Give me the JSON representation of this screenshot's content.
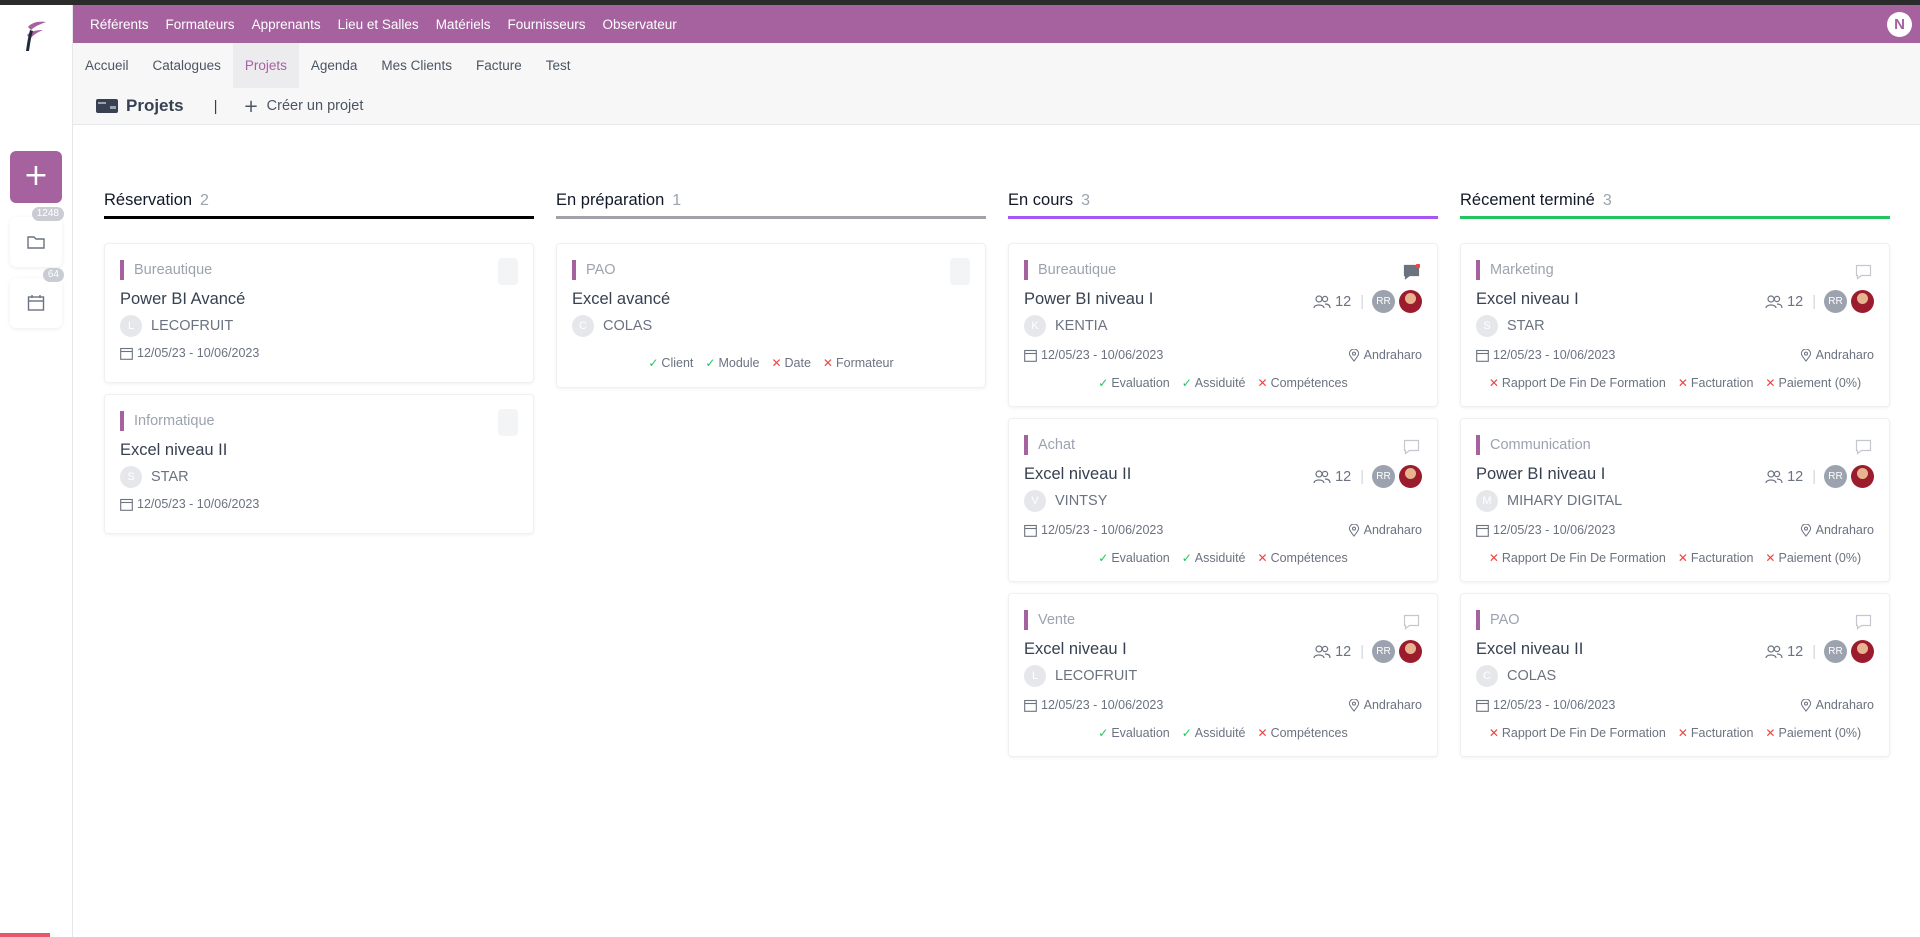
{
  "nav": {
    "top": [
      "Référents",
      "Formateurs",
      "Apprenants",
      "Lieu et Salles",
      "Matériels",
      "Fournisseurs",
      "Observateur"
    ],
    "user_initial": "N",
    "sub": [
      "Accueil",
      "Catalogues",
      "Projets",
      "Agenda",
      "Mes Clients",
      "Facture",
      "Test"
    ],
    "active_sub": "Projets"
  },
  "sidebar": {
    "add_label": "+",
    "folder_badge": "1248",
    "calendar_badge": "64"
  },
  "page": {
    "title": "Projets",
    "separator": "|",
    "create_label": "Créer un projet"
  },
  "colors": {
    "brand": "#a5629f",
    "col_reservation": "#000000",
    "col_preparation": "#a1a1aa",
    "col_encours": "#a855f7",
    "col_termine": "#22c55e"
  },
  "columns": [
    {
      "title": "Réservation",
      "count": "2",
      "cards": [
        {
          "category": "Bureautique",
          "name": "Power BI Avancé",
          "client_initial": "L",
          "client": "LECOFRUIT",
          "dates": "12/05/23 - 10/06/2023"
        },
        {
          "category": "Informatique",
          "name": "Excel niveau II",
          "client_initial": "S",
          "client": "STAR",
          "dates": "12/05/23 - 10/06/2023"
        }
      ]
    },
    {
      "title": "En préparation",
      "count": "1",
      "cards": [
        {
          "category": "PAO",
          "name": "Excel avancé",
          "client_initial": "C",
          "client": "COLAS",
          "checks": [
            {
              "ok": true,
              "label": "Client"
            },
            {
              "ok": true,
              "label": "Module"
            },
            {
              "ok": false,
              "label": "Date"
            },
            {
              "ok": false,
              "label": "Formateur"
            }
          ]
        }
      ]
    },
    {
      "title": "En cours",
      "count": "3",
      "cards": [
        {
          "category": "Bureautique",
          "name": "Power BI niveau I",
          "client_initial": "K",
          "client": "KENTIA",
          "dates": "12/05/23 - 10/06/2023",
          "place": "Andraharo",
          "participants": "12",
          "trainer": "RR",
          "checks": [
            {
              "ok": true,
              "label": "Evaluation"
            },
            {
              "ok": true,
              "label": "Assiduité"
            },
            {
              "ok": false,
              "label": "Compétences"
            }
          ]
        },
        {
          "category": "Achat",
          "name": "Excel niveau II",
          "client_initial": "V",
          "client": "VINTSY",
          "dates": "12/05/23 - 10/06/2023",
          "place": "Andraharo",
          "participants": "12",
          "trainer": "RR",
          "checks": [
            {
              "ok": true,
              "label": "Evaluation"
            },
            {
              "ok": true,
              "label": "Assiduité"
            },
            {
              "ok": false,
              "label": "Compétences"
            }
          ]
        },
        {
          "category": "Vente",
          "name": "Excel niveau I",
          "client_initial": "L",
          "client": "LECOFRUIT",
          "dates": "12/05/23 - 10/06/2023",
          "place": "Andraharo",
          "participants": "12",
          "trainer": "RR",
          "checks": [
            {
              "ok": true,
              "label": "Evaluation"
            },
            {
              "ok": true,
              "label": "Assiduité"
            },
            {
              "ok": false,
              "label": "Compétences"
            }
          ]
        }
      ]
    },
    {
      "title": "Récement terminé",
      "count": "3",
      "cards": [
        {
          "category": "Marketing",
          "name": "Excel niveau I",
          "client_initial": "S",
          "client": "STAR",
          "dates": "12/05/23 - 10/06/2023",
          "place": "Andraharo",
          "participants": "12",
          "trainer": "RR",
          "checks": [
            {
              "ok": false,
              "label": "Rapport De Fin De Formation"
            },
            {
              "ok": false,
              "label": "Facturation"
            },
            {
              "ok": false,
              "label": "Paiement (0%)"
            }
          ]
        },
        {
          "category": "Communication",
          "name": "Power BI niveau I",
          "client_initial": "M",
          "client": "MIHARY DIGITAL",
          "dates": "12/05/23 - 10/06/2023",
          "place": "Andraharo",
          "participants": "12",
          "trainer": "RR",
          "checks": [
            {
              "ok": false,
              "label": "Rapport De Fin De Formation"
            },
            {
              "ok": false,
              "label": "Facturation"
            },
            {
              "ok": false,
              "label": "Paiement (0%)"
            }
          ]
        },
        {
          "category": "PAO",
          "name": "Excel niveau II",
          "client_initial": "C",
          "client": "COLAS",
          "dates": "12/05/23 - 10/06/2023",
          "place": "Andraharo",
          "participants": "12",
          "trainer": "RR",
          "checks": [
            {
              "ok": false,
              "label": "Rapport De Fin De Formation"
            },
            {
              "ok": false,
              "label": "Facturation"
            },
            {
              "ok": false,
              "label": "Paiement (0%)"
            }
          ]
        }
      ]
    }
  ]
}
